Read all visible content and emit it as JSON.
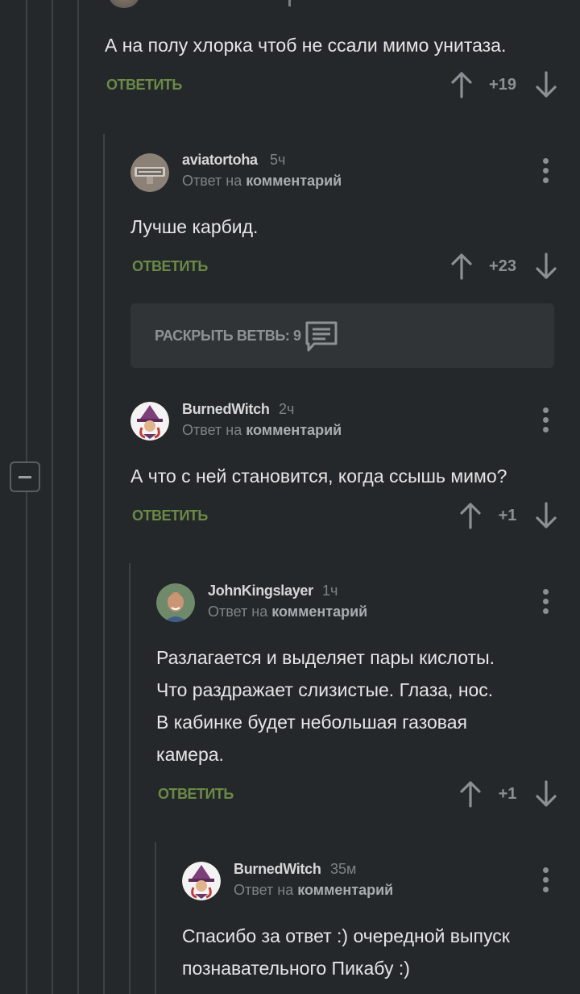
{
  "comments": [
    {
      "text_lines": [
        "А на полу хлорка чтоб не ссали мимо унитаза."
      ],
      "reply_label": "ОТВЕТИТЬ",
      "score": "+19"
    },
    {
      "author": "aviatortoha",
      "time": "5ч",
      "reply_prefix": "Ответ на",
      "reply_target": "комментарий",
      "text_lines": [
        "Лучше карбид."
      ],
      "reply_label": "ОТВЕТИТЬ",
      "score": "+23"
    },
    {
      "author": "BurnedWitch",
      "time": "2ч",
      "reply_prefix": "Ответ на",
      "reply_target": "комментарий",
      "text_lines": [
        "А что с ней становится, когда ссышь мимо?"
      ],
      "reply_label": "ОТВЕТИТЬ",
      "score": "+1"
    },
    {
      "author": "JohnKingslayer",
      "time": "1ч",
      "reply_prefix": "Ответ на",
      "reply_target": "комментарий",
      "text_lines": [
        "Разлагается и выделяет пары кислоты.",
        "Что раздражает слизистые. Глаза, нос.",
        "В кабинке будет небольшая газовая",
        "камера."
      ],
      "reply_label": "ОТВЕТИТЬ",
      "score": "+1"
    },
    {
      "author": "BurnedWitch",
      "time": "35м",
      "reply_prefix": "Ответ на",
      "reply_target": "комментарий",
      "text_lines": [
        "Спасибо за ответ :) очередной выпуск",
        "познавательного Пикабу :)"
      ]
    }
  ],
  "expand_branch": {
    "label": "РАСКРЫТЬ ВЕТВЬ: 9"
  },
  "icons": {
    "upvote": "arrow-up-icon",
    "downvote": "arrow-down-icon",
    "more": "kebab-menu-icon",
    "collapse": "minus-icon",
    "branch": "comments-icon"
  },
  "colors": {
    "background": "#25282b",
    "reply_link": "#6a8a46",
    "text": "#e6e6e6",
    "muted": "#7f8387"
  }
}
